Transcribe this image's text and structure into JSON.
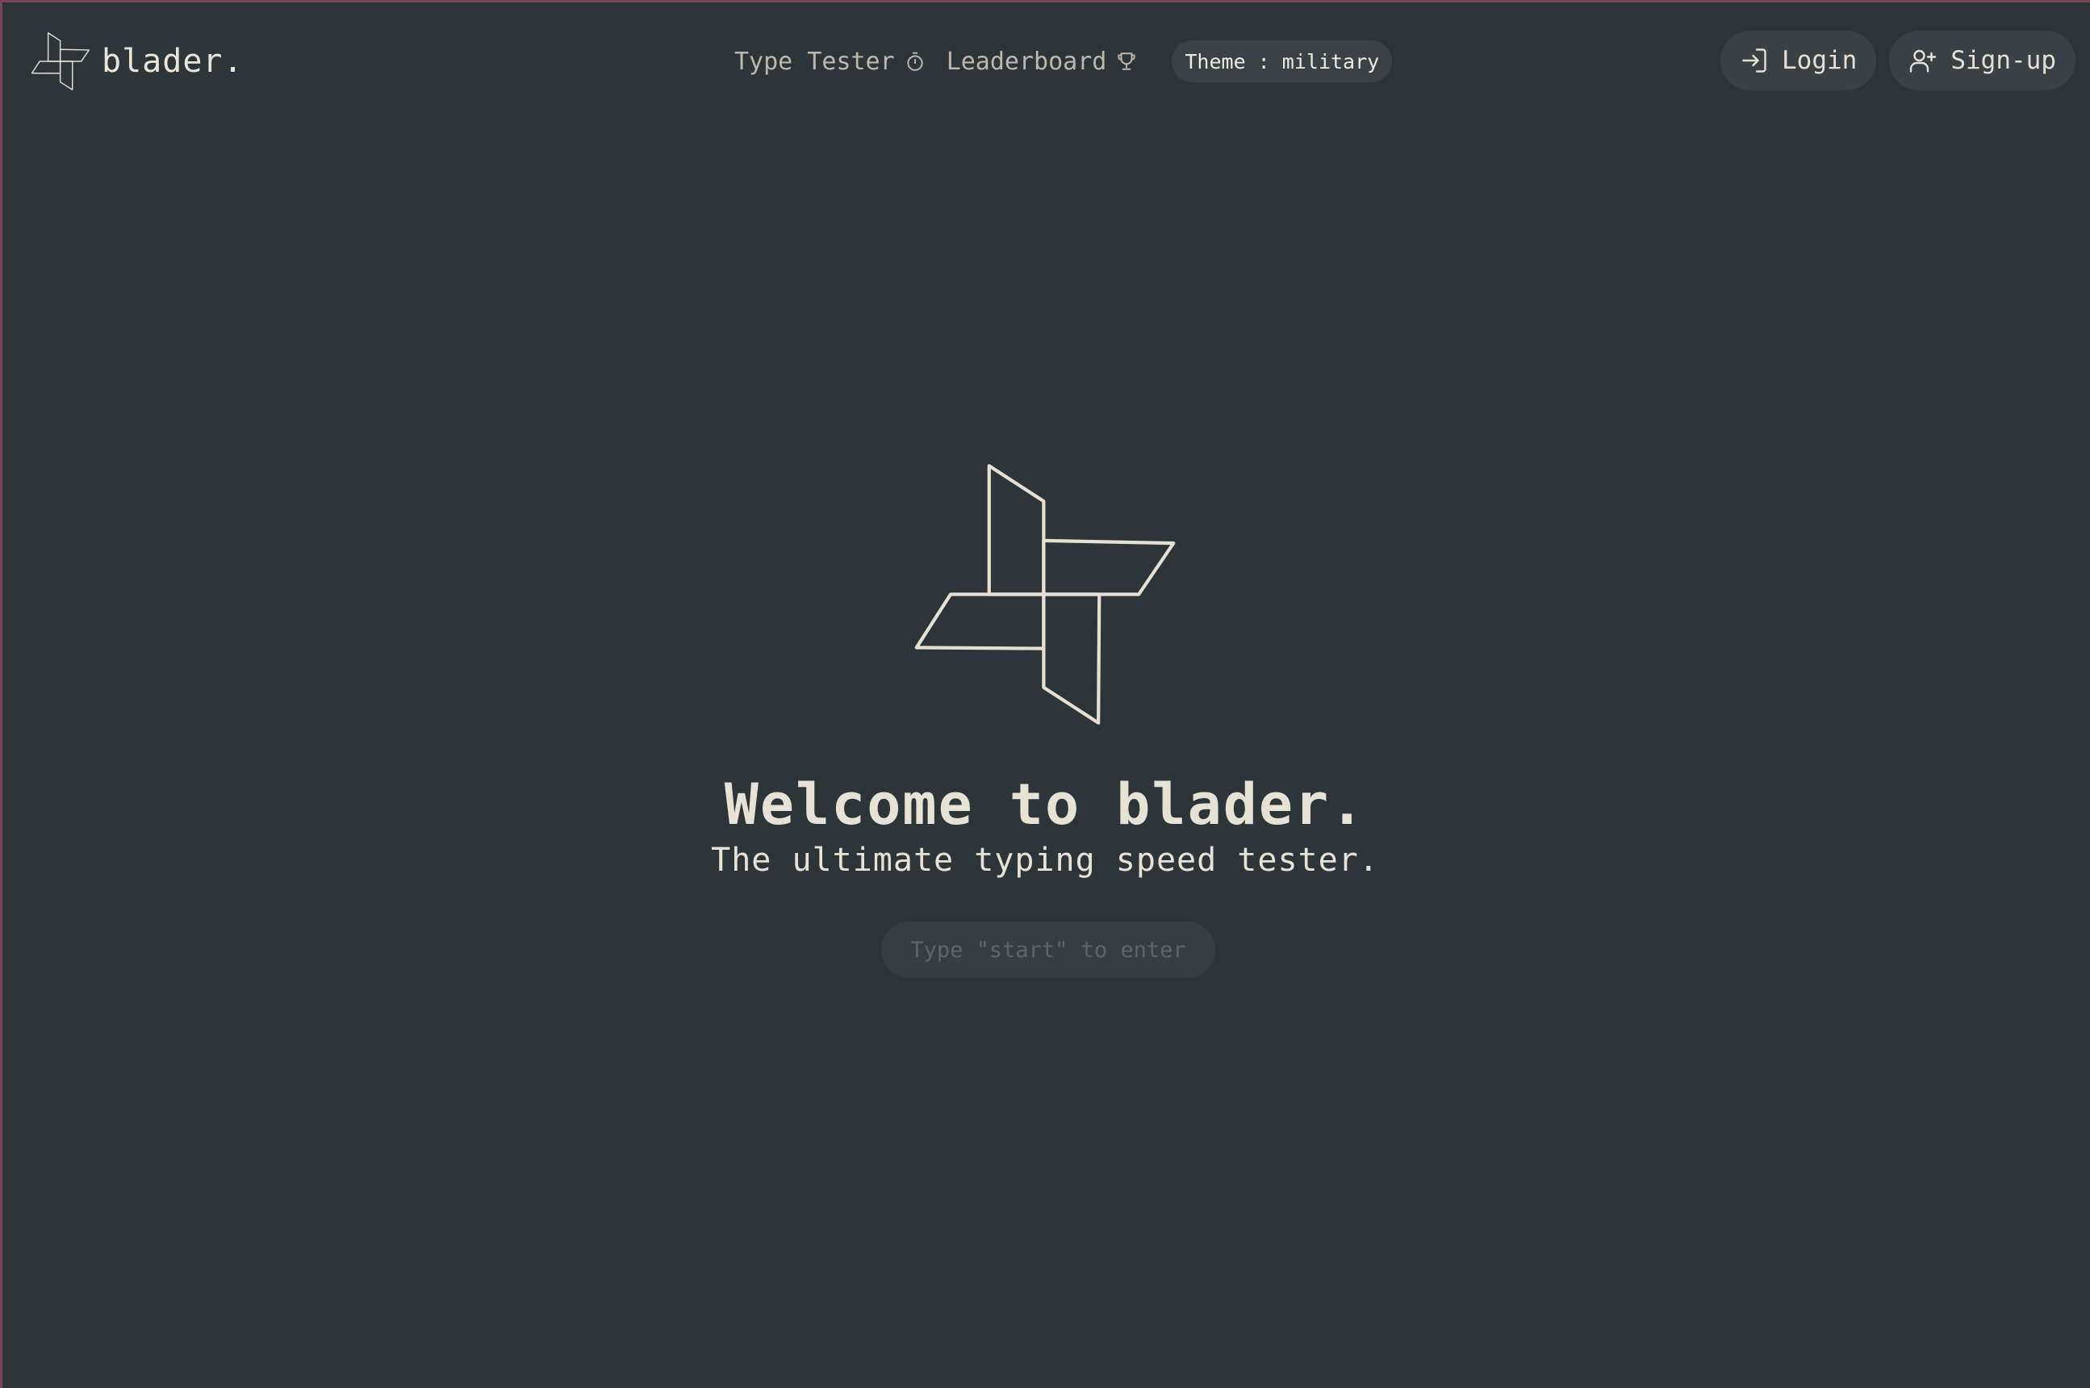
{
  "brand": {
    "name": "blader.",
    "logo_icon": "pinwheel-icon"
  },
  "nav": {
    "type_tester": {
      "label": "Type Tester",
      "icon": "stopwatch-icon"
    },
    "leaderboard": {
      "label": "Leaderboard",
      "icon": "trophy-icon"
    },
    "theme": {
      "label": "Theme : military"
    }
  },
  "auth": {
    "login": {
      "label": "Login",
      "icon": "login-icon"
    },
    "signup": {
      "label": "Sign-up",
      "icon": "user-plus-icon"
    }
  },
  "hero": {
    "title": "Welcome to blader.",
    "subtitle": "The ultimate typing speed tester.",
    "input": {
      "placeholder": "Type \"start\" to enter",
      "value": ""
    }
  },
  "colors": {
    "background": "#2e3539",
    "text": "#e5e0d3",
    "muted_text": "#bcb8ae",
    "pill_background": "#394145",
    "frame_accent": "#7b4657"
  }
}
